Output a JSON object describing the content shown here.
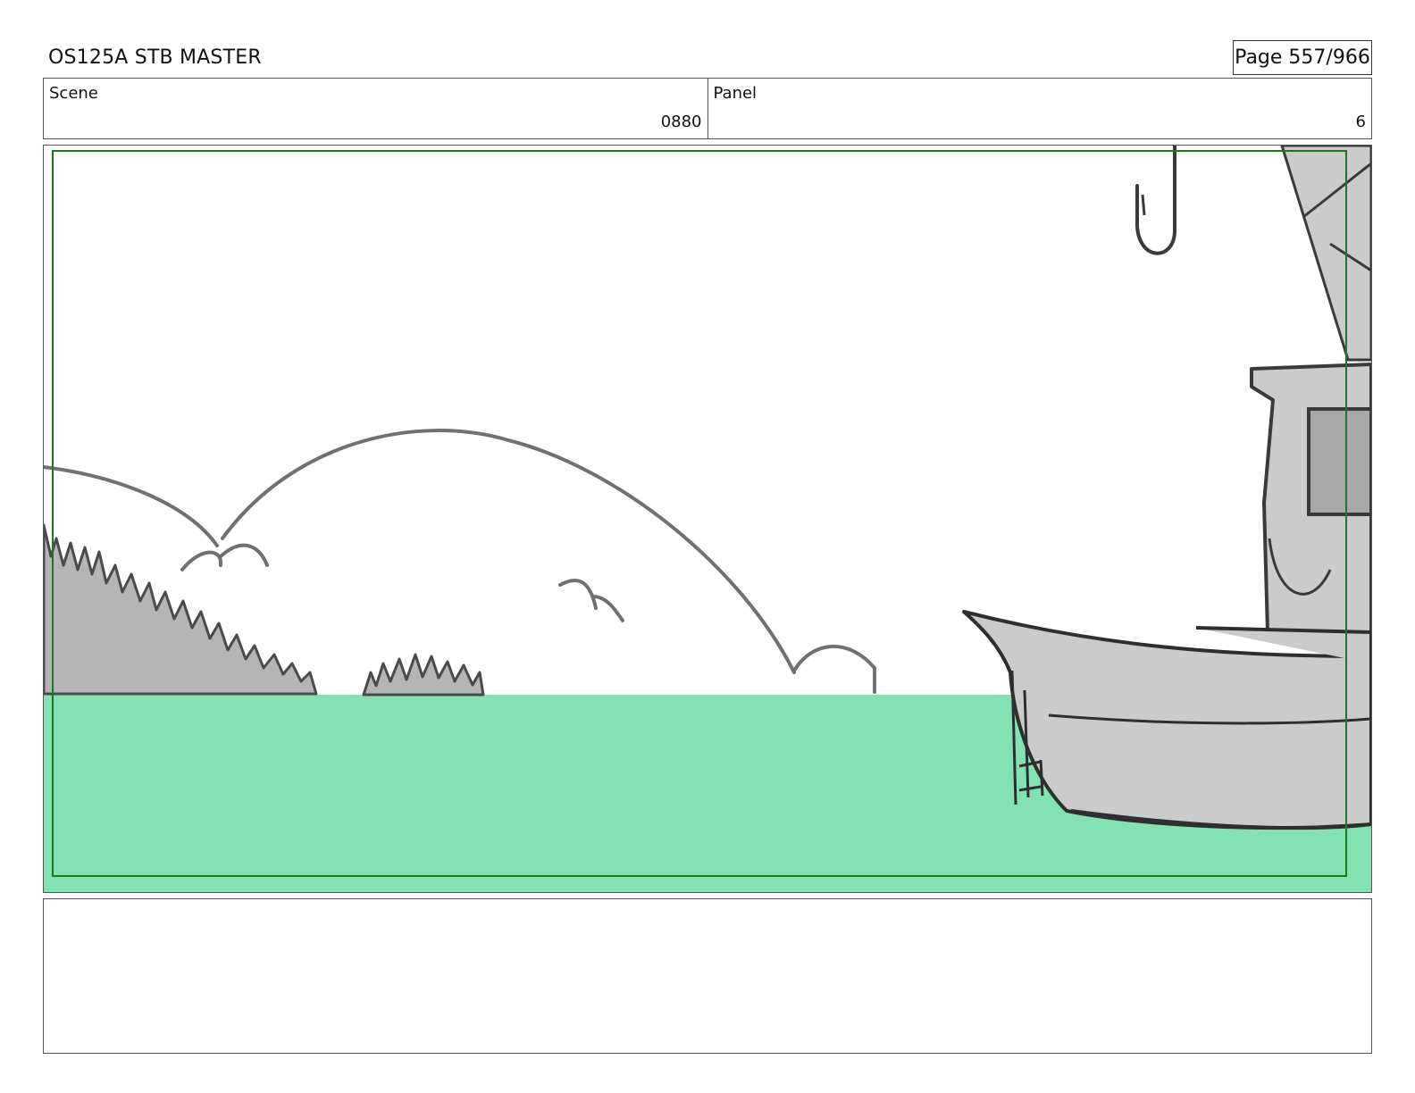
{
  "header": {
    "title": "OS125A STB MASTER",
    "page": "Page 557/966"
  },
  "meta": {
    "scene_label": "Scene",
    "scene_value": "0880",
    "panel_label": "Panel",
    "panel_value": "6"
  },
  "panel": {
    "colors": {
      "water": "#82e2b1",
      "safe_frame": "#1e7a1e",
      "boat_fill": "#cbcbcb",
      "hill_fill": "#b5b5b5",
      "line": "#3a3a3a"
    },
    "icons": [
      "hill-sketch",
      "boat-sketch",
      "hook-sketch"
    ]
  },
  "notes": {
    "text": ""
  }
}
